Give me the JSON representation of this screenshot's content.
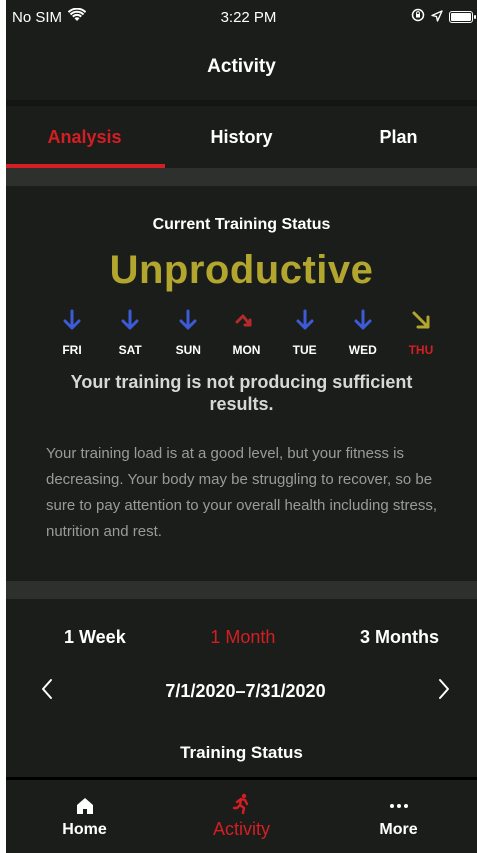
{
  "status_bar": {
    "carrier": "No SIM",
    "time": "3:22 PM"
  },
  "header": {
    "title": "Activity"
  },
  "tabs": [
    {
      "label": "Analysis",
      "active": true
    },
    {
      "label": "History",
      "active": false
    },
    {
      "label": "Plan",
      "active": false
    }
  ],
  "training_status": {
    "heading": "Current Training Status",
    "value": "Unproductive",
    "value_color": "#b3a62e",
    "days": [
      {
        "label": "FRI",
        "trend": "down",
        "color": "#3d5bd6"
      },
      {
        "label": "SAT",
        "trend": "down",
        "color": "#3d5bd6"
      },
      {
        "label": "SUN",
        "trend": "down",
        "color": "#3d5bd6"
      },
      {
        "label": "MON",
        "trend": "peak-down",
        "color": "#b52a2a"
      },
      {
        "label": "TUE",
        "trend": "down",
        "color": "#3d5bd6"
      },
      {
        "label": "WED",
        "trend": "down",
        "color": "#3d5bd6"
      },
      {
        "label": "THU",
        "trend": "down-right",
        "color": "#b3a62e",
        "today": true
      }
    ],
    "summary": "Your training is not producing sufficient results.",
    "description": "Your training load is at a good level, but your fitness is decreasing. Your body may be struggling to recover, so be sure to pay attention to your overall health including stress, nutrition and rest."
  },
  "ranges": [
    {
      "label": "1 Week",
      "active": false
    },
    {
      "label": "1 Month",
      "active": true
    },
    {
      "label": "3 Months",
      "active": false
    }
  ],
  "date_range": "7/1/2020–7/31/2020",
  "section_title": "Training Status",
  "bottom_tabs": [
    {
      "label": "Home",
      "icon": "home-icon",
      "active": false
    },
    {
      "label": "Activity",
      "icon": "runner-icon",
      "active": true
    },
    {
      "label": "More",
      "icon": "more-icon",
      "active": false
    }
  ],
  "colors": {
    "accent": "#d41e22",
    "background": "#1b1d1b"
  }
}
